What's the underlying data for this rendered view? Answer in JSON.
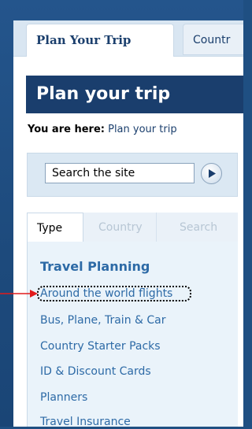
{
  "tabs": {
    "active_label": "Plan Your Trip",
    "inactive_label": "Countr"
  },
  "page_title": "Plan your trip",
  "breadcrumb": {
    "prefix": "You are here:",
    "current": "Plan your trip"
  },
  "search": {
    "value": "Search the site"
  },
  "subtabs": [
    "Type",
    "Country",
    "Search"
  ],
  "section": {
    "heading": "Travel Planning",
    "links": [
      "Around the world flights",
      "Bus, Plane, Train & Car",
      "Country Starter Packs",
      "ID & Discount Cards",
      "Planners",
      "Travel Insurance"
    ]
  },
  "colors": {
    "background": "#1f4f82",
    "title_bar": "#1a3e6d",
    "link": "#2d6aa6",
    "annotation_arrow": "#e11b1b"
  },
  "icons": [
    "play-arrow-icon",
    "annotation-arrow-icon"
  ]
}
